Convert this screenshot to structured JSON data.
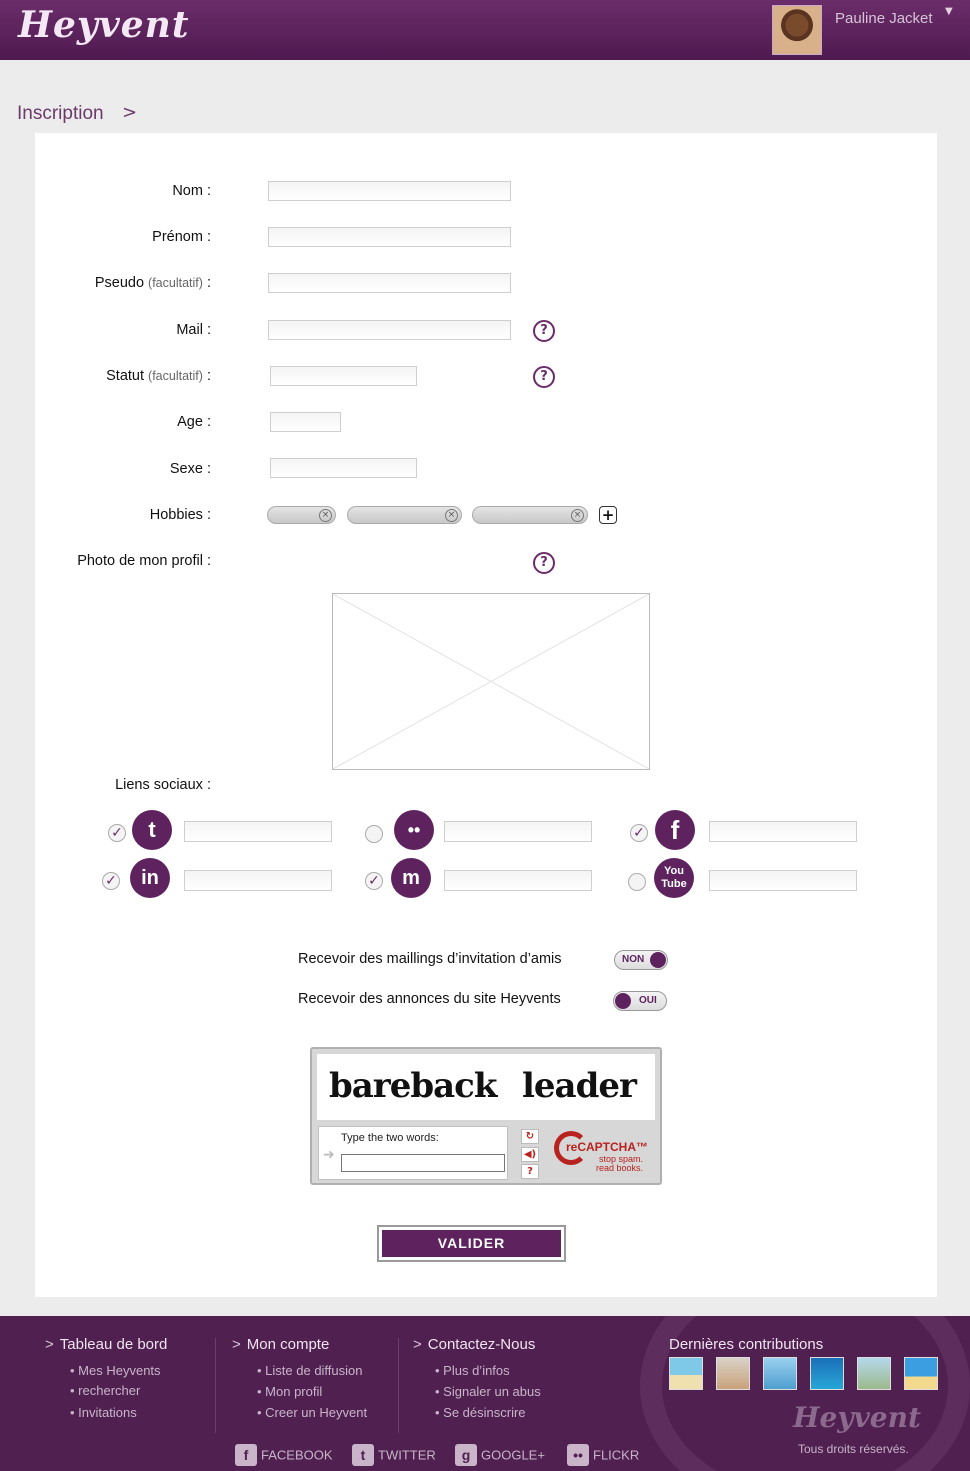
{
  "header": {
    "logo": "Heyvent",
    "user_name": "Pauline Jacket"
  },
  "breadcrumb": {
    "label": "Inscription"
  },
  "form": {
    "labels": {
      "nom": "Nom :",
      "prenom": "Prénom :",
      "pseudo": "Pseudo",
      "statut": "Statut",
      "optional": "(facultatif)",
      "colon": " :",
      "mail": "Mail :",
      "age": "Age :",
      "sexe": "Sexe :",
      "hobbies": "Hobbies :",
      "photo": "Photo de mon profil :",
      "social": "Liens sociaux :"
    },
    "help_glyph": "?",
    "add_glyph": "+",
    "remove_glyph": "×"
  },
  "social_links": [
    {
      "network": "twitter",
      "icon": "twitter-icon",
      "glyph": "t",
      "checked": true
    },
    {
      "network": "flickr",
      "icon": "flickr-icon",
      "glyph": "••",
      "checked": false
    },
    {
      "network": "facebook",
      "icon": "facebook-icon",
      "glyph": "f",
      "checked": true
    },
    {
      "network": "linkedin",
      "icon": "linkedin-icon",
      "glyph": "in",
      "checked": true
    },
    {
      "network": "myspace",
      "icon": "myspace-icon",
      "glyph": "m",
      "checked": true
    },
    {
      "network": "youtube",
      "icon": "youtube-icon",
      "glyph": "You Tube",
      "checked": false
    }
  ],
  "preferences": {
    "invitations_label": "Recevoir des maillings d’invitation d’amis",
    "invitations_toggle": "NON",
    "announcements_label": "Recevoir des annonces du site Heyvents",
    "announcements_toggle": "OUI"
  },
  "captcha": {
    "word1": "bareback",
    "word2": "leader",
    "prompt": "Type the two words:",
    "brand": "reCAPTCHA™",
    "tagline1": "stop spam.",
    "tagline2": "read books."
  },
  "submit_label": "VALIDER",
  "footer": {
    "col1": {
      "title": "Tableau de bord",
      "items": [
        "Mes Heyvents",
        "rechercher",
        "Invitations"
      ]
    },
    "col2": {
      "title": "Mon compte",
      "items": [
        "Liste de diffusion",
        "Mon profil",
        "Creer un Heyvent"
      ]
    },
    "col3": {
      "title": "Contactez-Nous",
      "items": [
        "Plus d’infos",
        "Signaler un abus",
        "Se désinscrire"
      ]
    },
    "contributions_title": "Dernières contributions",
    "logo": "Heyvent",
    "copyright": "Tous droits réservés.",
    "social": [
      "FACEBOOK",
      "TWITTER",
      "GOOGLE+",
      "FLICKR"
    ]
  },
  "colors": {
    "brand_purple": "#5e235f",
    "header_gradient_top": "#6b2d6a",
    "footer_bg": "#4f2050"
  }
}
